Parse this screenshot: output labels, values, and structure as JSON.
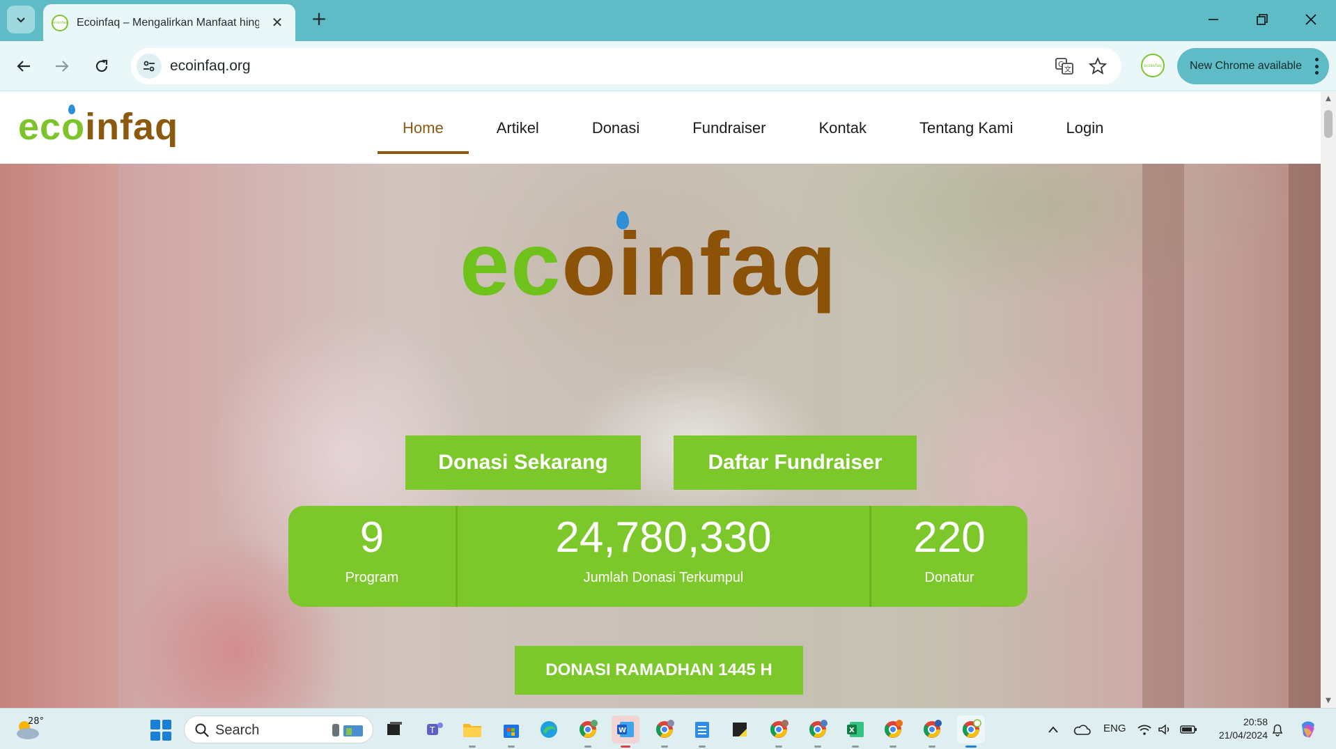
{
  "browser": {
    "tab_title": "Ecoinfaq – Mengalirkan Manfaat hingga",
    "url": "ecoinfaq.org",
    "update_label": "New Chrome available",
    "favicon_text": "ecoinfaq"
  },
  "site": {
    "logo_eco": "ec",
    "logo_o": "o",
    "logo_infaq": "infaq",
    "nav": [
      {
        "label": "Home",
        "active": true
      },
      {
        "label": "Artikel"
      },
      {
        "label": "Donasi"
      },
      {
        "label": "Fundraiser"
      },
      {
        "label": "Kontak"
      },
      {
        "label": "Tentang Kami"
      },
      {
        "label": "Login"
      }
    ]
  },
  "hero": {
    "donate_button": "Donasi Sekarang",
    "fundraiser_button": "Daftar Fundraiser",
    "stats": [
      {
        "value": "9",
        "label": "Program"
      },
      {
        "value": "24,780,330",
        "label": "Jumlah Donasi Terkumpul"
      },
      {
        "value": "220",
        "label": "Donatur"
      }
    ],
    "ramadhan_button": "DONASI RAMADHAN 1445 H"
  },
  "taskbar": {
    "weather_temp": "28°",
    "search_placeholder": "Search",
    "language": "ENG",
    "time": "20:58",
    "date": "21/04/2024"
  },
  "colors": {
    "brand_green": "#7cc72a",
    "brand_brown": "#8b5a0f",
    "chrome_teal": "#5fbcc6"
  }
}
